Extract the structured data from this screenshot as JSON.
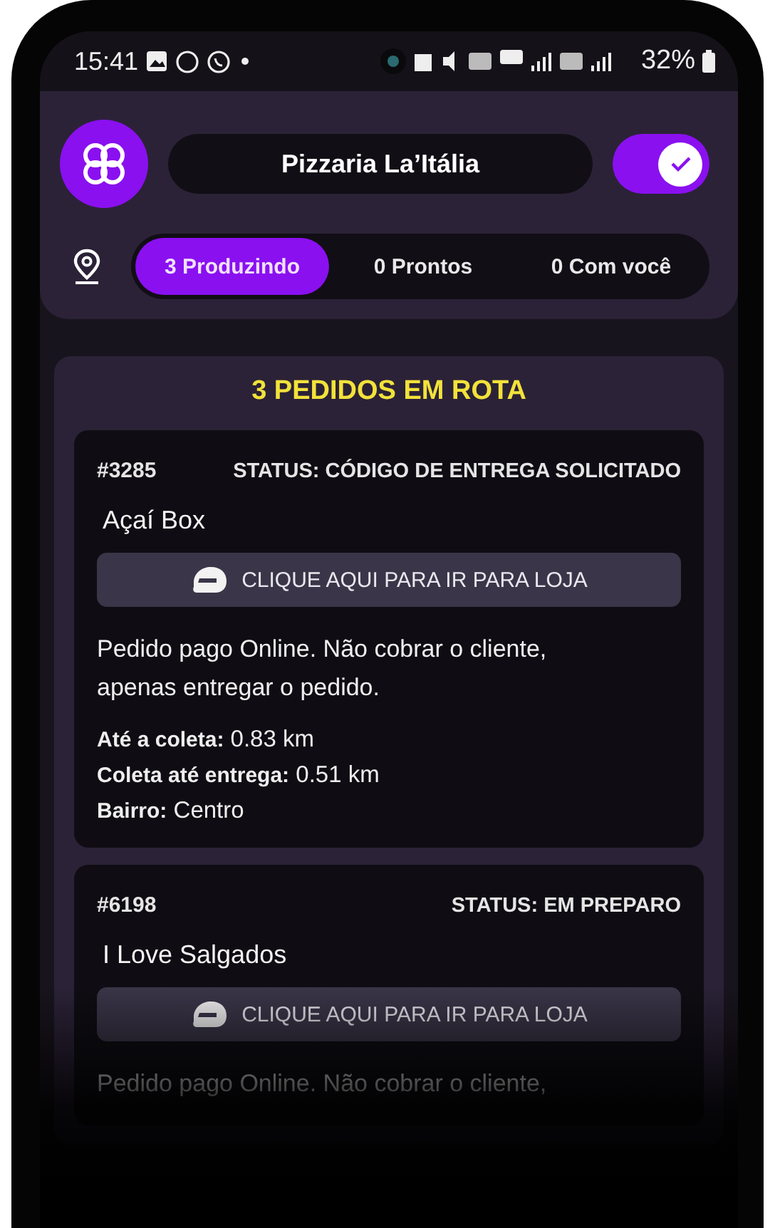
{
  "status_bar": {
    "time": "15:41",
    "battery": "32%"
  },
  "header": {
    "store_name": "Pizzaria La’Itália",
    "online": true
  },
  "tabs": [
    {
      "label": "3 Produzindo",
      "selected": true
    },
    {
      "label": "0 Prontos",
      "selected": false
    },
    {
      "label": "0 Com você",
      "selected": false
    }
  ],
  "panel": {
    "title": "3 PEDIDOS EM ROTA",
    "orders": [
      {
        "number": "#3285",
        "status": "STATUS: CÓDIGO DE ENTREGA SOLICITADO",
        "store": "Açaí Box",
        "button": "CLIQUE AQUI PARA IR PARA LOJA",
        "note": "Pedido pago Online. Não cobrar o cliente, apenas entregar o pedido.",
        "details": [
          {
            "label": "Até a coleta:",
            "value": "0.83 km"
          },
          {
            "label": "Coleta até entrega:",
            "value": "0.51 km"
          },
          {
            "label": "Bairro:",
            "value": "Centro"
          }
        ]
      },
      {
        "number": "#6198",
        "status": "STATUS: EM PREPARO",
        "store": "I Love Salgados",
        "button": "CLIQUE AQUI PARA IR PARA LOJA",
        "note": "Pedido pago Online. Não cobrar o cliente,"
      }
    ]
  }
}
